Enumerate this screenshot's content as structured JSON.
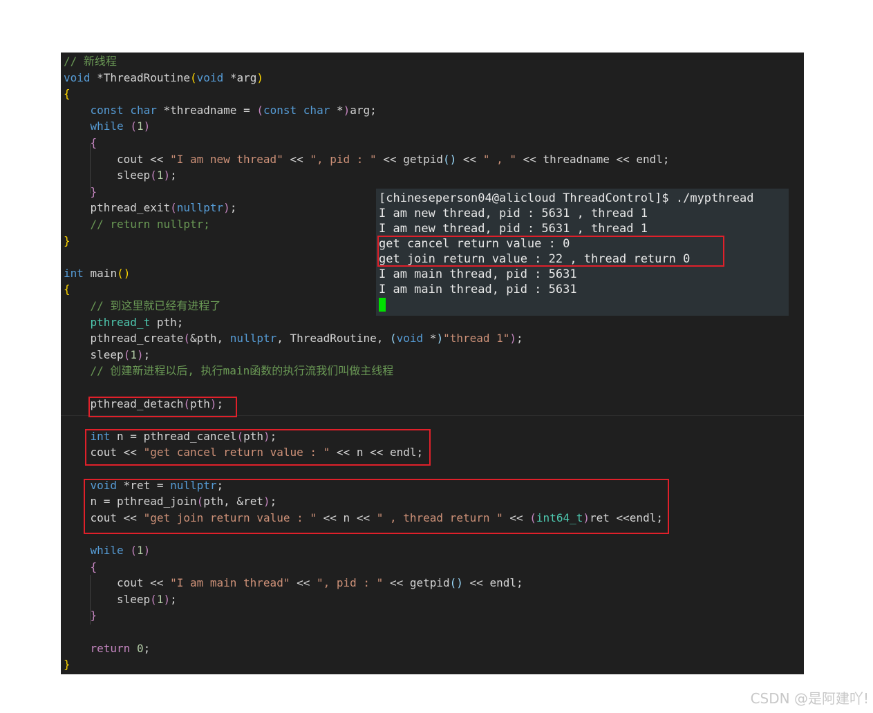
{
  "editor": {
    "colors": {
      "background": "#1f1f1f",
      "keyword": "#569cd6",
      "control": "#c586c0",
      "function": "#dcdcaa",
      "string": "#ce9178",
      "comment": "#6a9955",
      "number": "#b5cea8",
      "type": "#4ec9b0",
      "param": "#9cdcfe",
      "brace": "#ffd700"
    },
    "lines": [
      {
        "indent": 0,
        "tokens": [
          {
            "t": "// 新线程",
            "c": "comment"
          }
        ]
      },
      {
        "indent": 0,
        "tokens": [
          {
            "t": "void",
            "c": "keyword"
          },
          {
            "t": " *",
            "c": "plain"
          },
          {
            "t": "ThreadRoutine",
            "c": "plain"
          },
          {
            "t": "(",
            "c": "brace"
          },
          {
            "t": "void",
            "c": "keyword"
          },
          {
            "t": " *arg",
            "c": "plain"
          },
          {
            "t": ")",
            "c": "brace"
          }
        ]
      },
      {
        "indent": 0,
        "tokens": [
          {
            "t": "{",
            "c": "brace"
          }
        ]
      },
      {
        "indent": 1,
        "tokens": [
          {
            "t": "const",
            "c": "keyword"
          },
          {
            "t": " ",
            "c": "plain"
          },
          {
            "t": "char",
            "c": "keyword"
          },
          {
            "t": " *threadname = ",
            "c": "plain"
          },
          {
            "t": "(",
            "c": "control"
          },
          {
            "t": "const",
            "c": "keyword"
          },
          {
            "t": " ",
            "c": "plain"
          },
          {
            "t": "char",
            "c": "keyword"
          },
          {
            "t": " *",
            "c": "plain"
          },
          {
            "t": ")",
            "c": "control"
          },
          {
            "t": "arg;",
            "c": "plain"
          }
        ]
      },
      {
        "indent": 1,
        "tokens": [
          {
            "t": "while",
            "c": "keyword"
          },
          {
            "t": " ",
            "c": "plain"
          },
          {
            "t": "(",
            "c": "control"
          },
          {
            "t": "1",
            "c": "number"
          },
          {
            "t": ")",
            "c": "control"
          }
        ]
      },
      {
        "indent": 1,
        "tokens": [
          {
            "t": "{",
            "c": "control"
          }
        ]
      },
      {
        "indent": 2,
        "tokens": [
          {
            "t": "cout << ",
            "c": "plain"
          },
          {
            "t": "\"I am new thread\"",
            "c": "string"
          },
          {
            "t": " << ",
            "c": "plain"
          },
          {
            "t": "\", pid : \"",
            "c": "string"
          },
          {
            "t": " << getpid",
            "c": "plain"
          },
          {
            "t": "()",
            "c": "param"
          },
          {
            "t": " << ",
            "c": "plain"
          },
          {
            "t": "\" , \"",
            "c": "string"
          },
          {
            "t": " << threadname << endl;",
            "c": "plain"
          }
        ]
      },
      {
        "indent": 2,
        "tokens": [
          {
            "t": "sleep",
            "c": "plain"
          },
          {
            "t": "(",
            "c": "control"
          },
          {
            "t": "1",
            "c": "number"
          },
          {
            "t": ")",
            "c": "control"
          },
          {
            "t": ";",
            "c": "plain"
          }
        ]
      },
      {
        "indent": 1,
        "tokens": [
          {
            "t": "}",
            "c": "control"
          }
        ]
      },
      {
        "indent": 1,
        "tokens": [
          {
            "t": "pthread_exit",
            "c": "plain"
          },
          {
            "t": "(",
            "c": "control"
          },
          {
            "t": "nullptr",
            "c": "keyword"
          },
          {
            "t": ")",
            "c": "control"
          },
          {
            "t": ";",
            "c": "plain"
          }
        ]
      },
      {
        "indent": 1,
        "tokens": [
          {
            "t": "// return nullptr;",
            "c": "comment"
          }
        ]
      },
      {
        "indent": 0,
        "tokens": [
          {
            "t": "}",
            "c": "brace"
          }
        ]
      },
      {
        "indent": 0,
        "tokens": []
      },
      {
        "indent": 0,
        "tokens": [
          {
            "t": "int",
            "c": "keyword"
          },
          {
            "t": " main",
            "c": "plain"
          },
          {
            "t": "()",
            "c": "brace"
          }
        ]
      },
      {
        "indent": 0,
        "tokens": [
          {
            "t": "{",
            "c": "brace"
          }
        ]
      },
      {
        "indent": 1,
        "tokens": [
          {
            "t": "// 到这里就已经有进程了",
            "c": "comment"
          }
        ]
      },
      {
        "indent": 1,
        "tokens": [
          {
            "t": "pthread_t",
            "c": "type"
          },
          {
            "t": " pth;",
            "c": "plain"
          }
        ]
      },
      {
        "indent": 1,
        "tokens": [
          {
            "t": "pthread_create",
            "c": "plain"
          },
          {
            "t": "(",
            "c": "control"
          },
          {
            "t": "&pth, ",
            "c": "plain"
          },
          {
            "t": "nullptr",
            "c": "keyword"
          },
          {
            "t": ", ThreadRoutine, ",
            "c": "plain"
          },
          {
            "t": "(",
            "c": "param"
          },
          {
            "t": "void",
            "c": "keyword"
          },
          {
            "t": " *",
            "c": "plain"
          },
          {
            "t": ")",
            "c": "param"
          },
          {
            "t": "\"thread 1\"",
            "c": "string"
          },
          {
            "t": ")",
            "c": "control"
          },
          {
            "t": ";",
            "c": "plain"
          }
        ]
      },
      {
        "indent": 1,
        "tokens": [
          {
            "t": "sleep",
            "c": "plain"
          },
          {
            "t": "(",
            "c": "control"
          },
          {
            "t": "1",
            "c": "number"
          },
          {
            "t": ")",
            "c": "control"
          },
          {
            "t": ";",
            "c": "plain"
          }
        ]
      },
      {
        "indent": 1,
        "tokens": [
          {
            "t": "// 创建新进程以后, 执行main函数的执行流我们叫做主线程",
            "c": "comment"
          }
        ]
      },
      {
        "indent": 0,
        "tokens": []
      },
      {
        "indent": 1,
        "tokens": [
          {
            "t": "pthread_detach",
            "c": "plain"
          },
          {
            "t": "(",
            "c": "control"
          },
          {
            "t": "pth",
            "c": "plain"
          },
          {
            "t": ")",
            "c": "control"
          },
          {
            "t": ";",
            "c": "plain"
          }
        ]
      },
      {
        "indent": 0,
        "tokens": []
      },
      {
        "indent": 1,
        "tokens": [
          {
            "t": "int",
            "c": "keyword"
          },
          {
            "t": " n = pthread_cancel",
            "c": "plain"
          },
          {
            "t": "(",
            "c": "control"
          },
          {
            "t": "pth",
            "c": "plain"
          },
          {
            "t": ")",
            "c": "control"
          },
          {
            "t": ";",
            "c": "plain"
          }
        ]
      },
      {
        "indent": 1,
        "tokens": [
          {
            "t": "cout << ",
            "c": "plain"
          },
          {
            "t": "\"get cancel return value : \"",
            "c": "string"
          },
          {
            "t": " << n << endl;",
            "c": "plain"
          }
        ]
      },
      {
        "indent": 0,
        "tokens": []
      },
      {
        "indent": 1,
        "tokens": [
          {
            "t": "void",
            "c": "keyword"
          },
          {
            "t": " *ret = ",
            "c": "plain"
          },
          {
            "t": "nullptr",
            "c": "keyword"
          },
          {
            "t": ";",
            "c": "plain"
          }
        ]
      },
      {
        "indent": 1,
        "tokens": [
          {
            "t": "n = pthread_join",
            "c": "plain"
          },
          {
            "t": "(",
            "c": "control"
          },
          {
            "t": "pth, &ret",
            "c": "plain"
          },
          {
            "t": ")",
            "c": "control"
          },
          {
            "t": ";",
            "c": "plain"
          }
        ]
      },
      {
        "indent": 1,
        "tokens": [
          {
            "t": "cout << ",
            "c": "plain"
          },
          {
            "t": "\"get join return value : \"",
            "c": "string"
          },
          {
            "t": " << n << ",
            "c": "plain"
          },
          {
            "t": "\" , thread return \"",
            "c": "string"
          },
          {
            "t": " << ",
            "c": "plain"
          },
          {
            "t": "(",
            "c": "control"
          },
          {
            "t": "int64_t",
            "c": "type"
          },
          {
            "t": ")",
            "c": "control"
          },
          {
            "t": "ret <<endl;",
            "c": "plain"
          }
        ]
      },
      {
        "indent": 0,
        "tokens": []
      },
      {
        "indent": 1,
        "tokens": [
          {
            "t": "while",
            "c": "keyword"
          },
          {
            "t": " ",
            "c": "plain"
          },
          {
            "t": "(",
            "c": "control"
          },
          {
            "t": "1",
            "c": "number"
          },
          {
            "t": ")",
            "c": "control"
          }
        ]
      },
      {
        "indent": 1,
        "tokens": [
          {
            "t": "{",
            "c": "control"
          }
        ]
      },
      {
        "indent": 2,
        "tokens": [
          {
            "t": "cout << ",
            "c": "plain"
          },
          {
            "t": "\"I am main thread\"",
            "c": "string"
          },
          {
            "t": " << ",
            "c": "plain"
          },
          {
            "t": "\", pid : \"",
            "c": "string"
          },
          {
            "t": " << getpid",
            "c": "plain"
          },
          {
            "t": "()",
            "c": "param"
          },
          {
            "t": " << endl;",
            "c": "plain"
          }
        ]
      },
      {
        "indent": 2,
        "tokens": [
          {
            "t": "sleep",
            "c": "plain"
          },
          {
            "t": "(",
            "c": "control"
          },
          {
            "t": "1",
            "c": "number"
          },
          {
            "t": ")",
            "c": "control"
          },
          {
            "t": ";",
            "c": "plain"
          }
        ]
      },
      {
        "indent": 1,
        "tokens": [
          {
            "t": "}",
            "c": "control"
          }
        ]
      },
      {
        "indent": 0,
        "tokens": []
      },
      {
        "indent": 1,
        "tokens": [
          {
            "t": "return",
            "c": "control"
          },
          {
            "t": " ",
            "c": "plain"
          },
          {
            "t": "0",
            "c": "number"
          },
          {
            "t": ";",
            "c": "plain"
          }
        ]
      },
      {
        "indent": 0,
        "tokens": [
          {
            "t": "}",
            "c": "brace"
          }
        ]
      }
    ]
  },
  "terminal": {
    "background": "#2b3236",
    "cursor_color": "#00e000",
    "lines": [
      "[chineseperson04@alicloud ThreadControl]$ ./mypthread",
      "I am new thread, pid : 5631 , thread 1",
      "I am new thread, pid : 5631 , thread 1",
      "get cancel return value : 0",
      "get join return value : 22 , thread return 0",
      "I am main thread, pid : 5631",
      "I am main thread, pid : 5631"
    ]
  },
  "highlight_color": "#e0202a",
  "watermark": "CSDN @是阿建吖!"
}
